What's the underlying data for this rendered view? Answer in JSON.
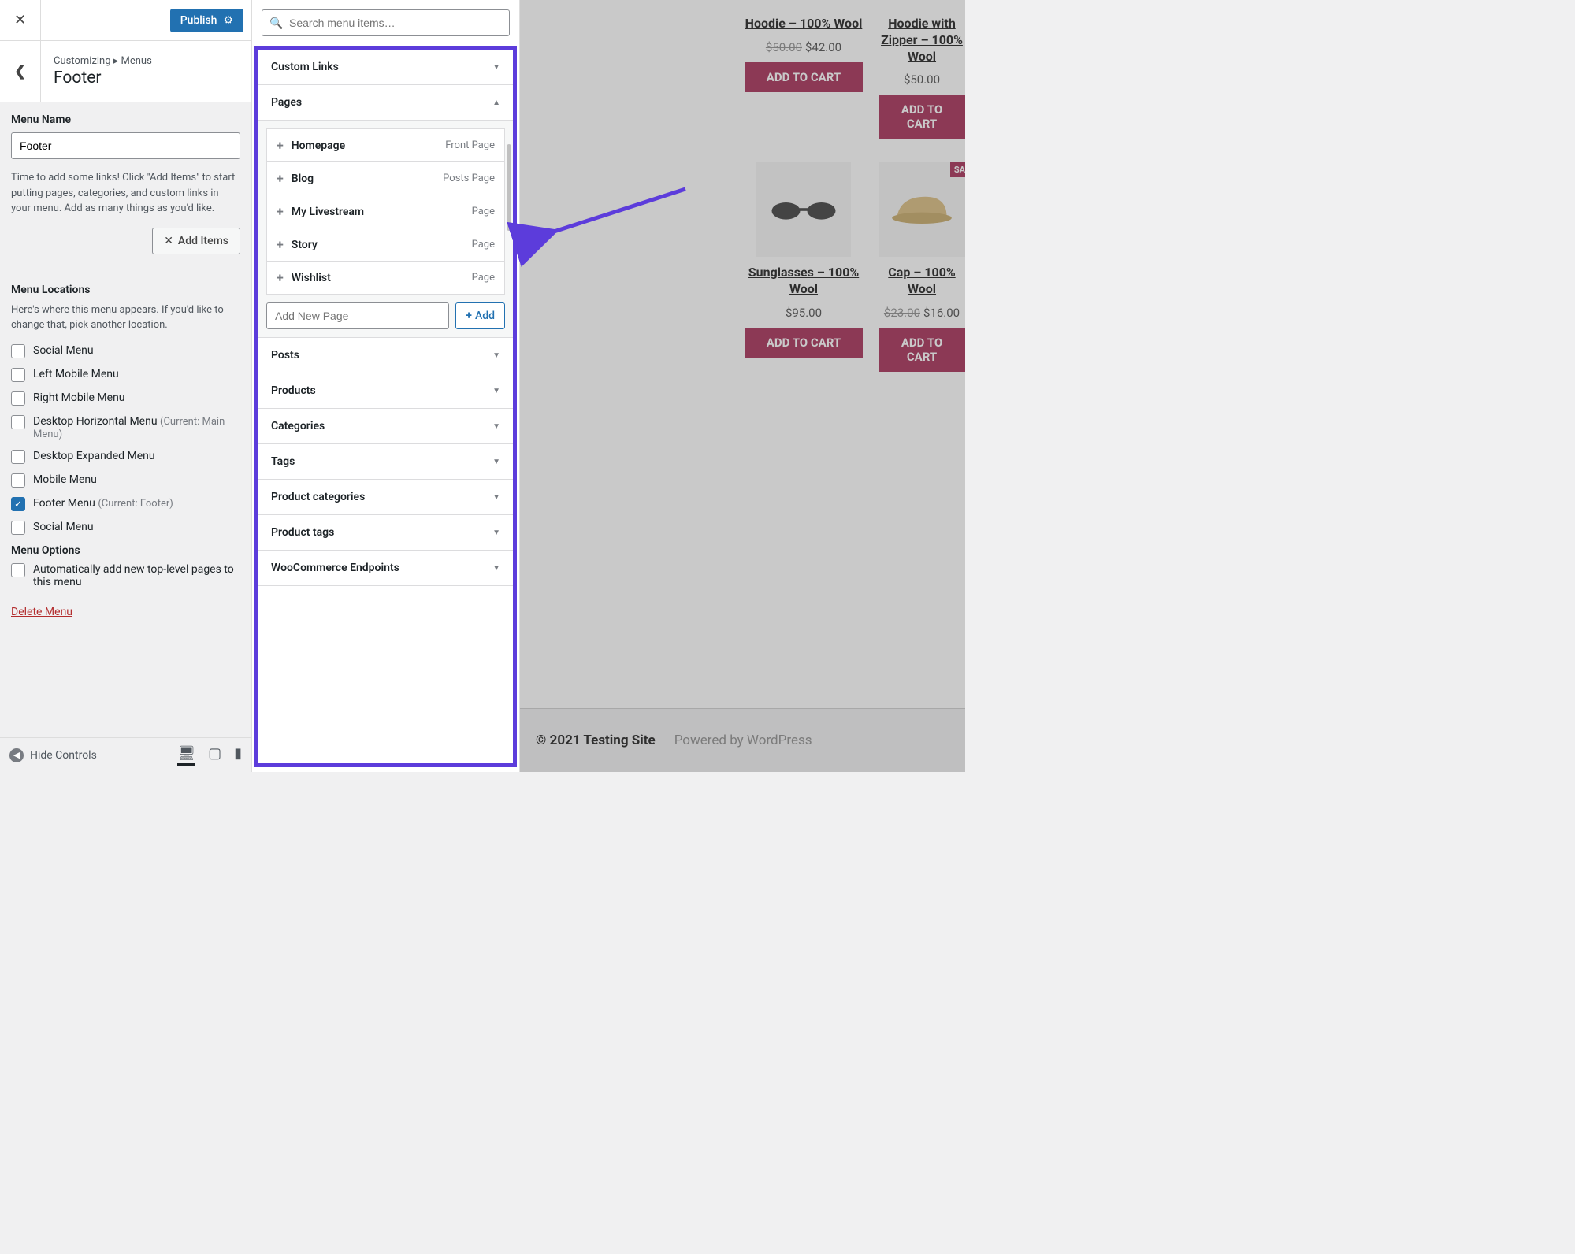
{
  "header": {
    "publish": "Publish"
  },
  "breadcrumb": {
    "path": "Customizing ▸ Menus",
    "title": "Footer"
  },
  "menu_name": {
    "label": "Menu Name",
    "value": "Footer"
  },
  "help_text": "Time to add some links! Click \"Add Items\" to start putting pages, categories, and custom links in your menu. Add as many things as you'd like.",
  "add_items_btn": "Add Items",
  "locations": {
    "heading": "Menu Locations",
    "desc": "Here's where this menu appears. If you'd like to change that, pick another location.",
    "items": [
      {
        "label": "Social Menu",
        "checked": false,
        "note": ""
      },
      {
        "label": "Left Mobile Menu",
        "checked": false,
        "note": ""
      },
      {
        "label": "Right Mobile Menu",
        "checked": false,
        "note": ""
      },
      {
        "label": "Desktop Horizontal Menu",
        "checked": false,
        "note": "(Current: Main Menu)"
      },
      {
        "label": "Desktop Expanded Menu",
        "checked": false,
        "note": ""
      },
      {
        "label": "Mobile Menu",
        "checked": false,
        "note": ""
      },
      {
        "label": "Footer Menu",
        "checked": true,
        "note": "(Current: Footer)"
      },
      {
        "label": "Social Menu",
        "checked": false,
        "note": ""
      }
    ]
  },
  "menu_options": {
    "heading": "Menu Options",
    "auto_add": "Automatically add new top-level pages to this menu"
  },
  "delete_menu": "Delete Menu",
  "hide_controls": "Hide Controls",
  "search_placeholder": "Search menu items…",
  "accordion": {
    "custom_links": "Custom Links",
    "pages": "Pages",
    "posts": "Posts",
    "products": "Products",
    "categories": "Categories",
    "tags": "Tags",
    "product_categories": "Product categories",
    "product_tags": "Product tags",
    "wc_endpoints": "WooCommerce Endpoints"
  },
  "pages_list": [
    {
      "name": "Homepage",
      "type": "Front Page"
    },
    {
      "name": "Blog",
      "type": "Posts Page"
    },
    {
      "name": "My Livestream",
      "type": "Page"
    },
    {
      "name": "Story",
      "type": "Page"
    },
    {
      "name": "Wishlist",
      "type": "Page"
    }
  ],
  "add_new_page_placeholder": "Add New Page",
  "add_btn": "Add",
  "products_row1": [
    {
      "title": "Hoodie – 100% Wool",
      "old": "$50.00",
      "price": "$42.00",
      "btn": "ADD TO CART"
    },
    {
      "title": "Hoodie with Zipper – 100% Wool",
      "old": "",
      "price": "$50.00",
      "btn": "ADD TO CART"
    }
  ],
  "products_row2": [
    {
      "title": "Sunglasses – 100% Wool",
      "old": "",
      "price": "$95.00",
      "btn": "ADD TO CART",
      "sale": ""
    },
    {
      "title": "Cap – 100% Wool",
      "old": "$23.00",
      "price": "$16.00",
      "btn": "ADD TO CART",
      "sale": "SALE"
    }
  ],
  "footer": {
    "copyright": "© 2021 Testing Site",
    "powered": "Powered by WordPress"
  }
}
